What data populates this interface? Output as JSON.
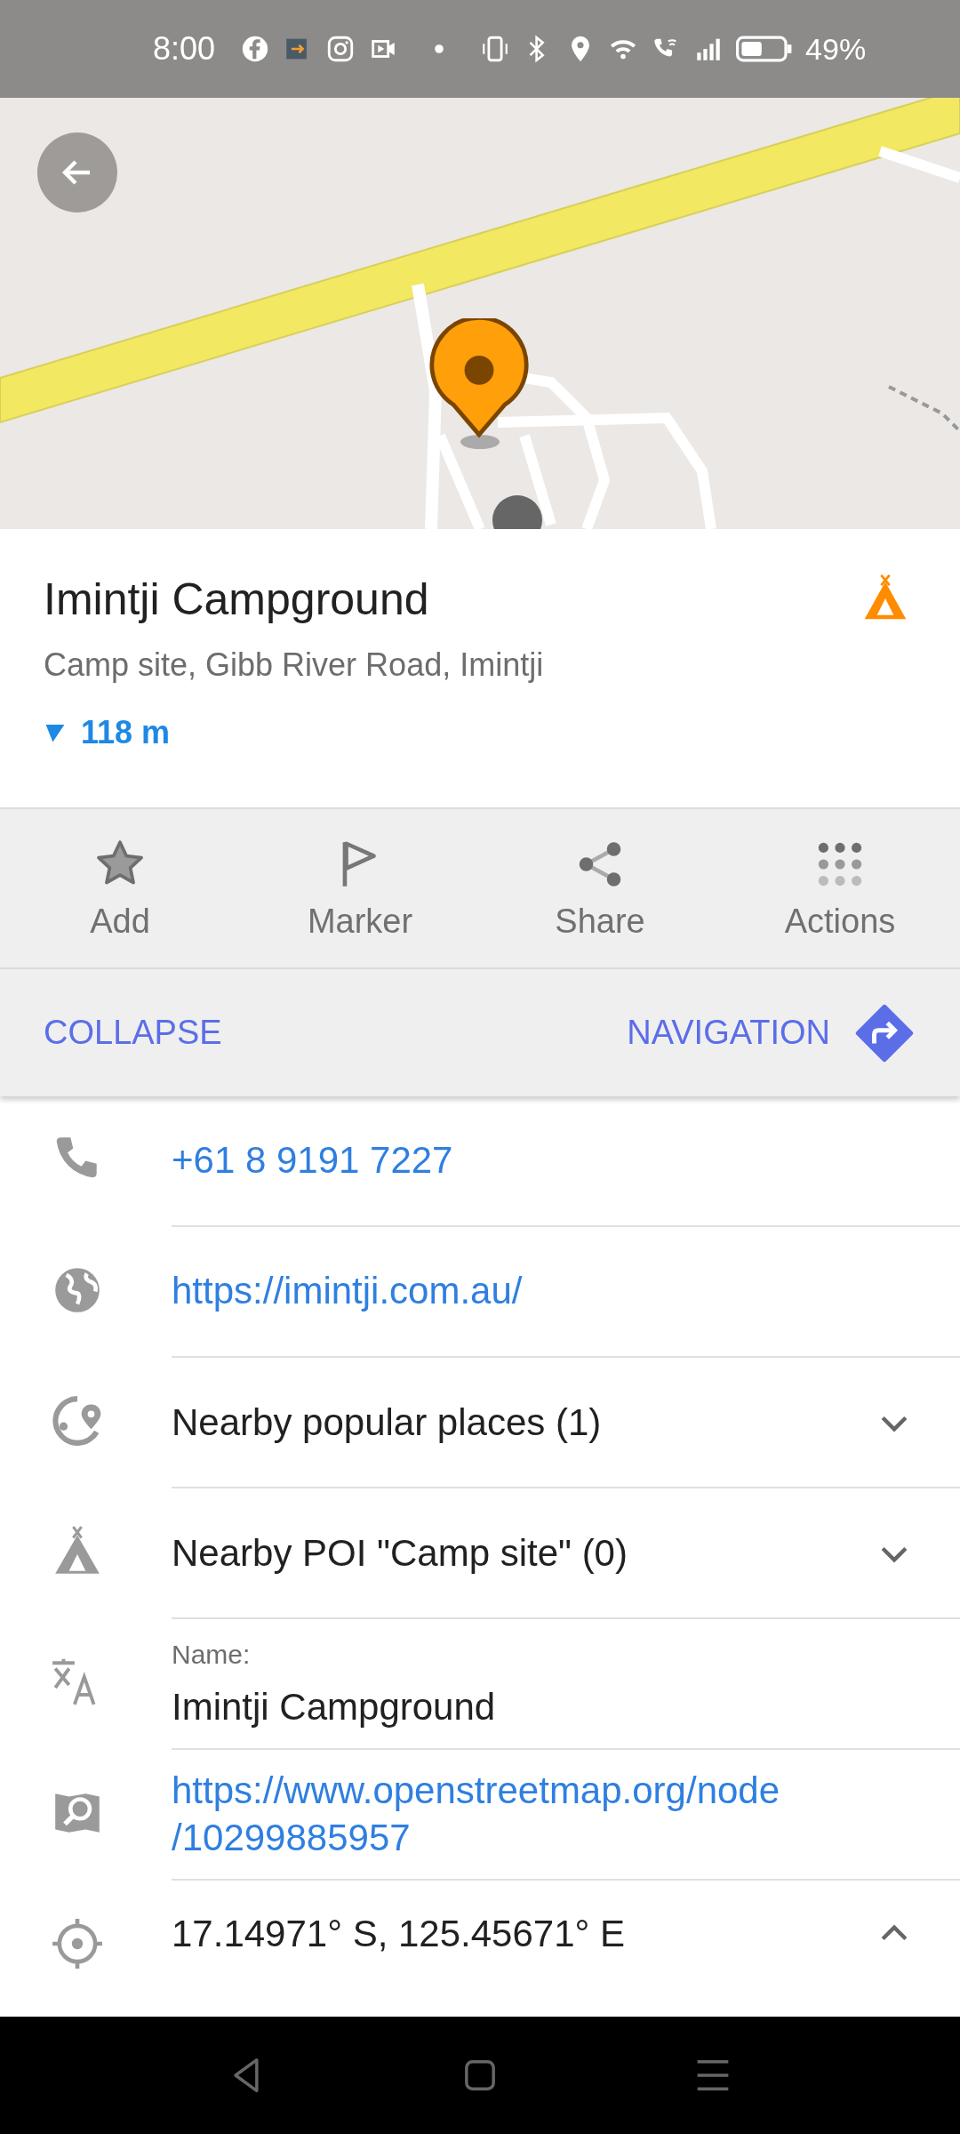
{
  "status_bar": {
    "time": "8:00",
    "battery": "49%"
  },
  "place": {
    "title": "Imintji Campground",
    "subtitle": "Camp site, Gibb River Road, Imintji",
    "distance": "118 m"
  },
  "actions": [
    {
      "label": "Add"
    },
    {
      "label": "Marker"
    },
    {
      "label": "Share"
    },
    {
      "label": "Actions"
    }
  ],
  "bottom_buttons": {
    "collapse": "COLLAPSE",
    "navigation": "NAVIGATION"
  },
  "details": [
    {
      "kind": "link",
      "text": "+61 8 9191 7227"
    },
    {
      "kind": "link",
      "text": "https://imintji.com.au/"
    },
    {
      "kind": "expandable",
      "text": "Nearby popular places (1)",
      "expanded": false
    },
    {
      "kind": "expandable",
      "text": "Nearby POI \"Camp site\" (0)",
      "expanded": false
    },
    {
      "kind": "field",
      "label": "Name:",
      "text": "Imintji Campground"
    },
    {
      "kind": "link",
      "text": "https://www.openstreetmap.org/node\n/10299885957"
    },
    {
      "kind": "expandable",
      "text": "17.14971° S, 125.45671° E",
      "expanded": true
    }
  ]
}
